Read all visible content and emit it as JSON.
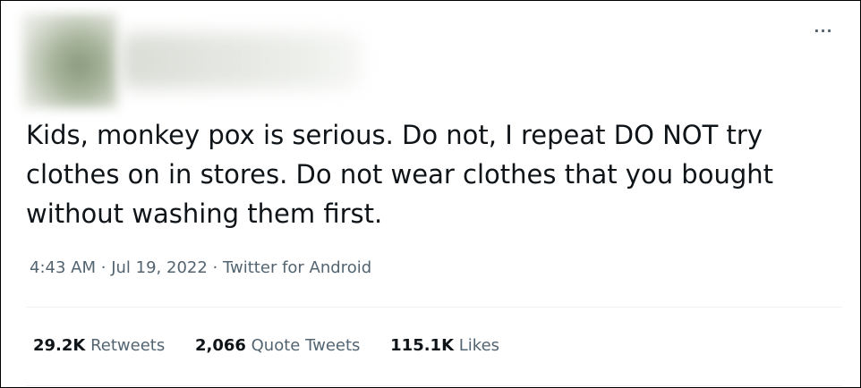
{
  "tweet": {
    "text": "Kids, monkey pox is serious. Do not, I repeat DO NOT try clothes on in stores. Do not wear clothes that you bought without washing them first.",
    "time": "4:43 AM",
    "date": "Jul 19, 2022",
    "source": "Twitter for Android",
    "separator": "·",
    "more_icon": "more-horizontal-icon",
    "more_glyph": "···"
  },
  "stats": {
    "retweets": {
      "count": "29.2K",
      "label": "Retweets"
    },
    "quote_tweets": {
      "count": "2,066",
      "label": "Quote Tweets"
    },
    "likes": {
      "count": "115.1K",
      "label": "Likes"
    }
  },
  "colors": {
    "text_primary": "#0f1419",
    "text_secondary": "#536471",
    "divider": "#eff3f4"
  }
}
